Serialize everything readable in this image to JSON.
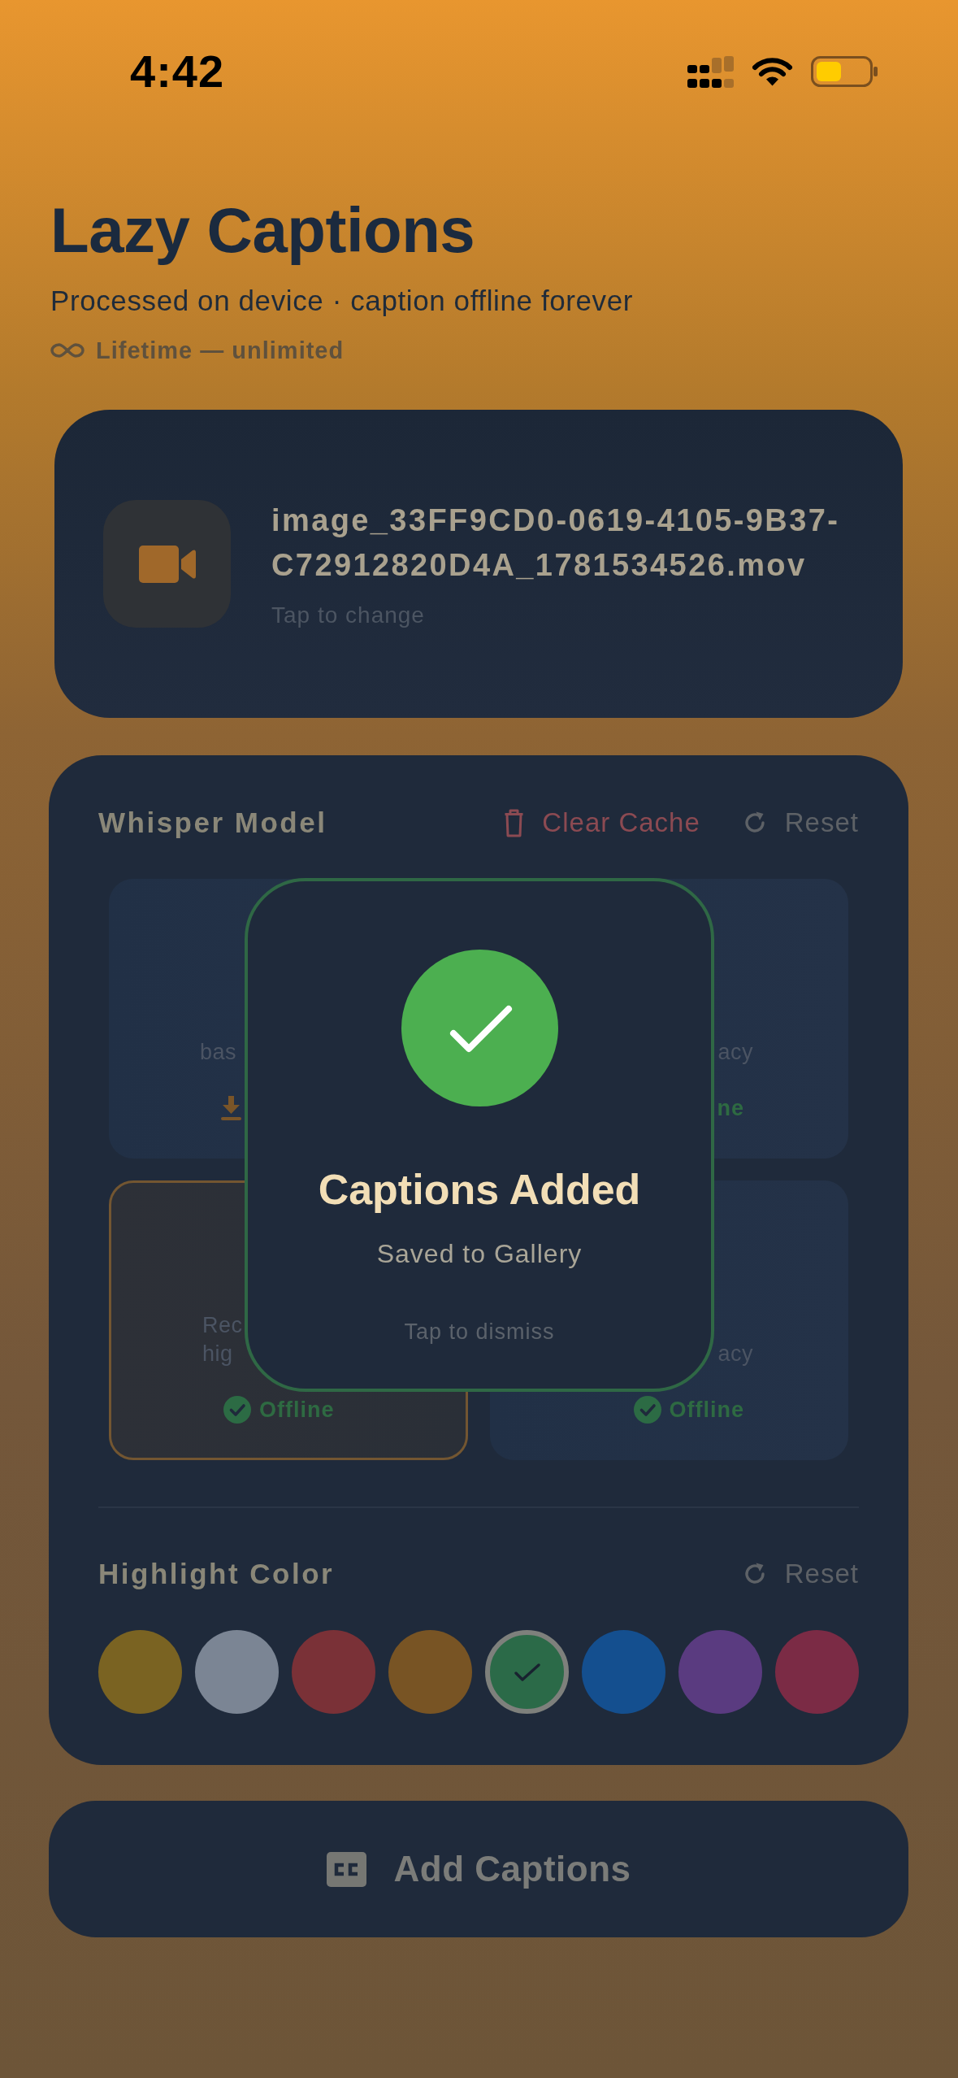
{
  "status_bar": {
    "time": "4:42"
  },
  "header": {
    "title": "Lazy Captions",
    "subtitle": "Processed on device · caption offline forever",
    "plan": "Lifetime — unlimited"
  },
  "file_card": {
    "file_name": "image_33FF9CD0-0619-4105-9B37-C72912820D4A_1781534526.mov",
    "hint": "Tap to change"
  },
  "model_section": {
    "title": "Whisper Model",
    "actions": [
      {
        "kind": "clear",
        "label": "Clear Cache"
      },
      {
        "kind": "reset",
        "label": "Reset"
      }
    ],
    "models": [
      {
        "selected": false,
        "description": [
          "bas"
        ],
        "status": {
          "kind": "download"
        }
      },
      {
        "selected": false,
        "description": [
          "acy"
        ],
        "status": {
          "kind": "text",
          "label": "ne"
        }
      },
      {
        "selected": true,
        "description": [
          "Rec",
          "hig"
        ],
        "status": {
          "kind": "offline",
          "label": "Offline"
        }
      },
      {
        "selected": false,
        "description": [
          "acy"
        ],
        "status": {
          "kind": "offline",
          "label": "Offline"
        }
      }
    ]
  },
  "highlight_section": {
    "title": "Highlight Color",
    "actions": [
      {
        "kind": "reset",
        "label": "Reset"
      }
    ],
    "colors": [
      {
        "color": "#7a6322",
        "selected": false
      },
      {
        "color": "#7b8594",
        "selected": false
      },
      {
        "color": "#7a3137",
        "selected": false
      },
      {
        "color": "#785424",
        "selected": false
      },
      {
        "color": "#2b6a48",
        "selected": true
      },
      {
        "color": "#144f8f",
        "selected": false
      },
      {
        "color": "#5a3b80",
        "selected": false
      },
      {
        "color": "#7b2b45",
        "selected": false
      }
    ]
  },
  "primary_button": {
    "label": "Add Captions"
  },
  "toast": {
    "title": "Captions Added",
    "message": "Saved to Gallery",
    "hint": "Tap to dismiss"
  }
}
